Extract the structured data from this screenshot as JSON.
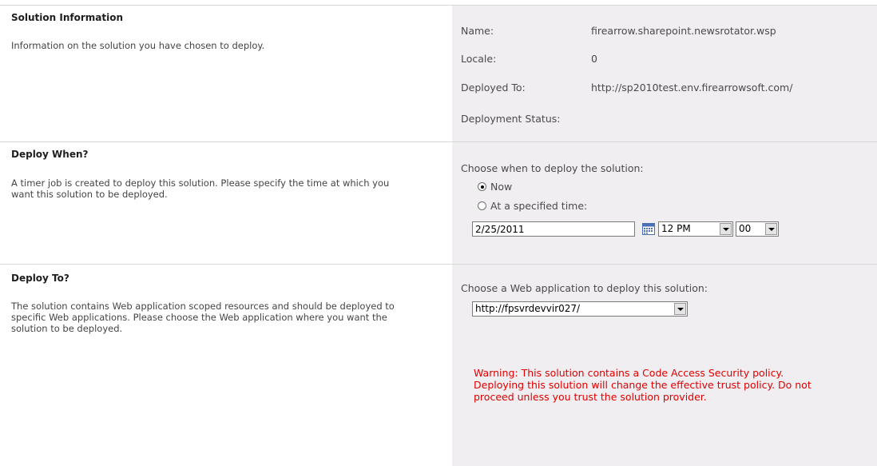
{
  "solution_info": {
    "title": "Solution Information",
    "description": "Information on the solution you have chosen to deploy.",
    "name_label": "Name:",
    "name_value": "firearrow.sharepoint.newsrotator.wsp",
    "locale_label": "Locale:",
    "locale_value": "0",
    "deployed_to_label": "Deployed To:",
    "deployed_to_value": "http://sp2010test.env.firearrowsoft.com/",
    "status_label": "Deployment Status:"
  },
  "deploy_when": {
    "title": "Deploy When?",
    "description": "A timer job is created to deploy this solution. Please specify the time at which you want this solution to be deployed.",
    "prompt": "Choose when to deploy the solution:",
    "option_now": "Now",
    "option_specified": "At a specified time:",
    "selected": "now",
    "date_value": "2/25/2011",
    "hour_value": "12 PM",
    "minute_value": "00"
  },
  "deploy_to": {
    "title": "Deploy To?",
    "description": "The solution contains Web application scoped resources and should be deployed to specific Web applications. Please choose the Web application where you want the solution to be deployed.",
    "prompt": "Choose a Web application to deploy this solution:",
    "web_app_value": "http://fpsvrdevvir027/",
    "warning": "Warning: This solution contains a Code Access Security policy. Deploying this solution will change the effective trust policy. Do not proceed unless you trust the solution provider."
  },
  "colors": {
    "right_panel_bg": "#f1eef1",
    "warning_text": "#e00000"
  }
}
